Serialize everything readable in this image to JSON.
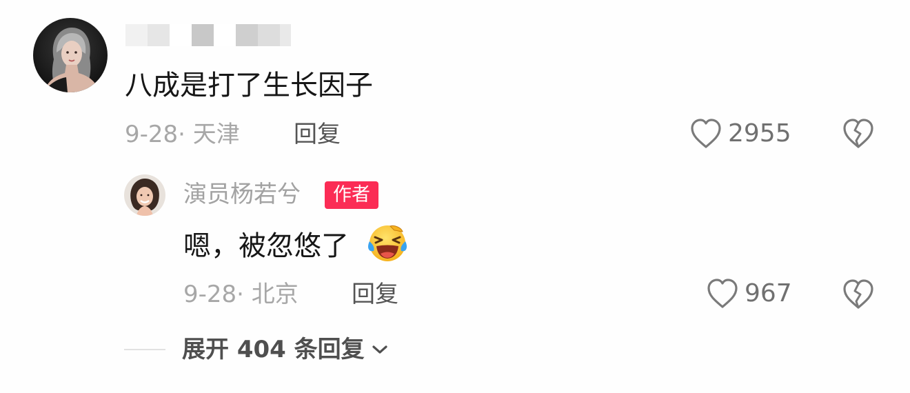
{
  "main_comment": {
    "username_redacted": "",
    "text": "八成是打了生长因子",
    "date_location": "9-28· 天津",
    "reply_label": "回复",
    "likes": "2955"
  },
  "reply_comment": {
    "author": "演员杨若兮",
    "badge": "作者",
    "text": "嗯，被忽悠了",
    "emoji": "laughing-crying-face",
    "date_location": "9-28· 北京",
    "reply_label": "回复",
    "likes": "967"
  },
  "expand": {
    "label": "展开 404 条回复"
  },
  "colors": {
    "badge": "#fb2c55",
    "text": "#161616",
    "meta": "#a7a7a7"
  }
}
